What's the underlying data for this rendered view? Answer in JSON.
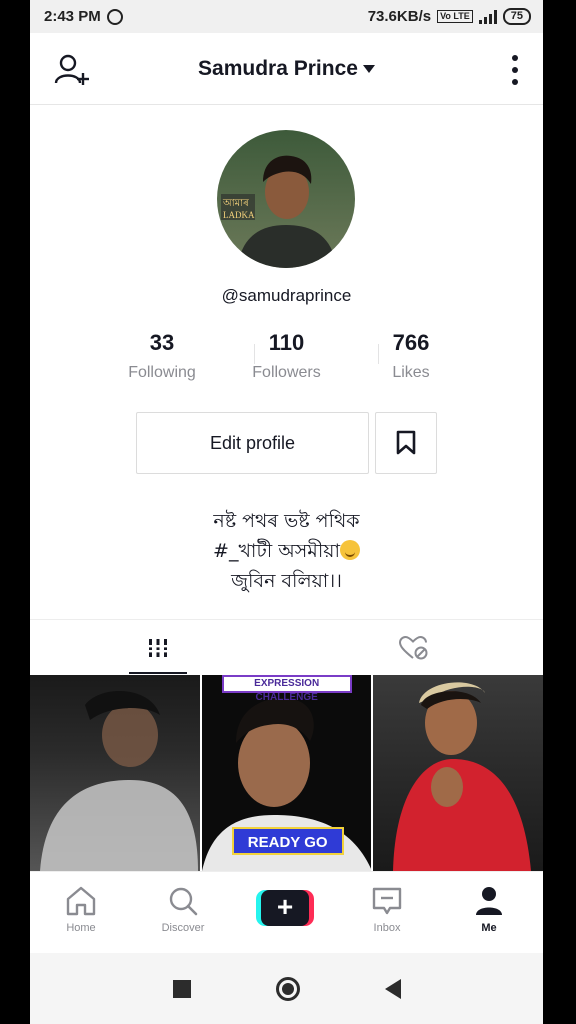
{
  "status_bar": {
    "time": "2:43 PM",
    "speed": "73.6KB/s",
    "volte": "Vo LTE",
    "network": "4G",
    "battery": "75"
  },
  "header": {
    "username": "Samudra Prince"
  },
  "profile": {
    "handle": "@samudraprince",
    "avatar_text": "আমাৰ LADKA",
    "stats": [
      {
        "value": "33",
        "label": "Following"
      },
      {
        "value": "110",
        "label": "Followers"
      },
      {
        "value": "766",
        "label": "Likes"
      }
    ],
    "edit_label": "Edit profile",
    "bio_lines": [
      "নষ্ট পথৰ ভষ্ট পথিক",
      "#_খাটী অসমীয়া",
      "জুবিন বলিয়া।।"
    ]
  },
  "videos": [
    {
      "overlay": ""
    },
    {
      "top_banner": "EXPRESSION CHALLENGE",
      "bottom_banner": "READY GO"
    },
    {
      "overlay": ""
    }
  ],
  "bottom_nav": [
    {
      "label": "Home",
      "icon": "home-icon"
    },
    {
      "label": "Discover",
      "icon": "search-icon"
    },
    {
      "label": "",
      "icon": "create-icon"
    },
    {
      "label": "Inbox",
      "icon": "inbox-icon"
    },
    {
      "label": "Me",
      "icon": "profile-icon"
    }
  ],
  "colors": {
    "accent_cyan": "#25f4ee",
    "accent_red": "#fe2c55",
    "text": "#161823",
    "muted": "#8a8b91"
  }
}
